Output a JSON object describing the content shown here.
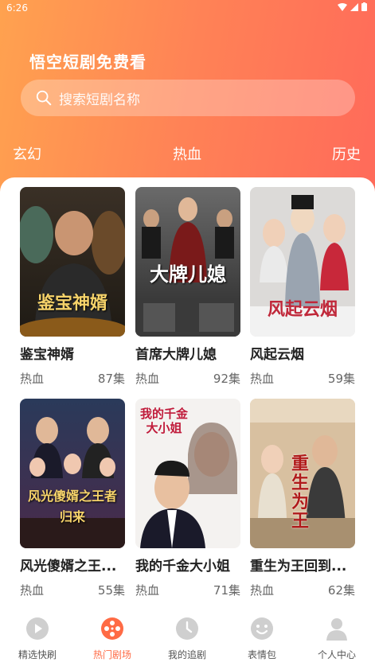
{
  "status": {
    "time": "6:26"
  },
  "header": {
    "title": "悟空短剧免费看"
  },
  "search": {
    "placeholder": "搜索短剧名称"
  },
  "tabs": [
    {
      "label": "玄幻"
    },
    {
      "label": "热血"
    },
    {
      "label": "历史"
    }
  ],
  "dramas": [
    {
      "title": "鉴宝神婿",
      "genre": "热血",
      "episodes": "87集",
      "poster_text": "鉴宝神婿"
    },
    {
      "title": "首席大牌儿媳",
      "genre": "热血",
      "episodes": "92集",
      "poster_text": "大牌儿媳"
    },
    {
      "title": "风起云烟",
      "genre": "热血",
      "episodes": "59集",
      "poster_text": "风起云烟"
    },
    {
      "title": "风光傻婿之王...",
      "genre": "热血",
      "episodes": "55集",
      "poster_text": "风光傻婿之王者归来"
    },
    {
      "title": "我的千金大小姐",
      "genre": "热血",
      "episodes": "71集",
      "poster_text": "我的千金大小姐"
    },
    {
      "title": "重生为王回到...",
      "genre": "热血",
      "episodes": "62集",
      "poster_text": "重生为王"
    }
  ],
  "nav": [
    {
      "label": "精选快刷",
      "icon": "play-icon"
    },
    {
      "label": "热门剧场",
      "icon": "film-reel-icon"
    },
    {
      "label": "我的追剧",
      "icon": "clock-icon"
    },
    {
      "label": "表情包",
      "icon": "smiley-icon"
    },
    {
      "label": "个人中心",
      "icon": "person-icon"
    }
  ],
  "colors": {
    "accent": "#ff6b45",
    "header_start": "#ffa24f",
    "header_end": "#ff6a5a"
  }
}
